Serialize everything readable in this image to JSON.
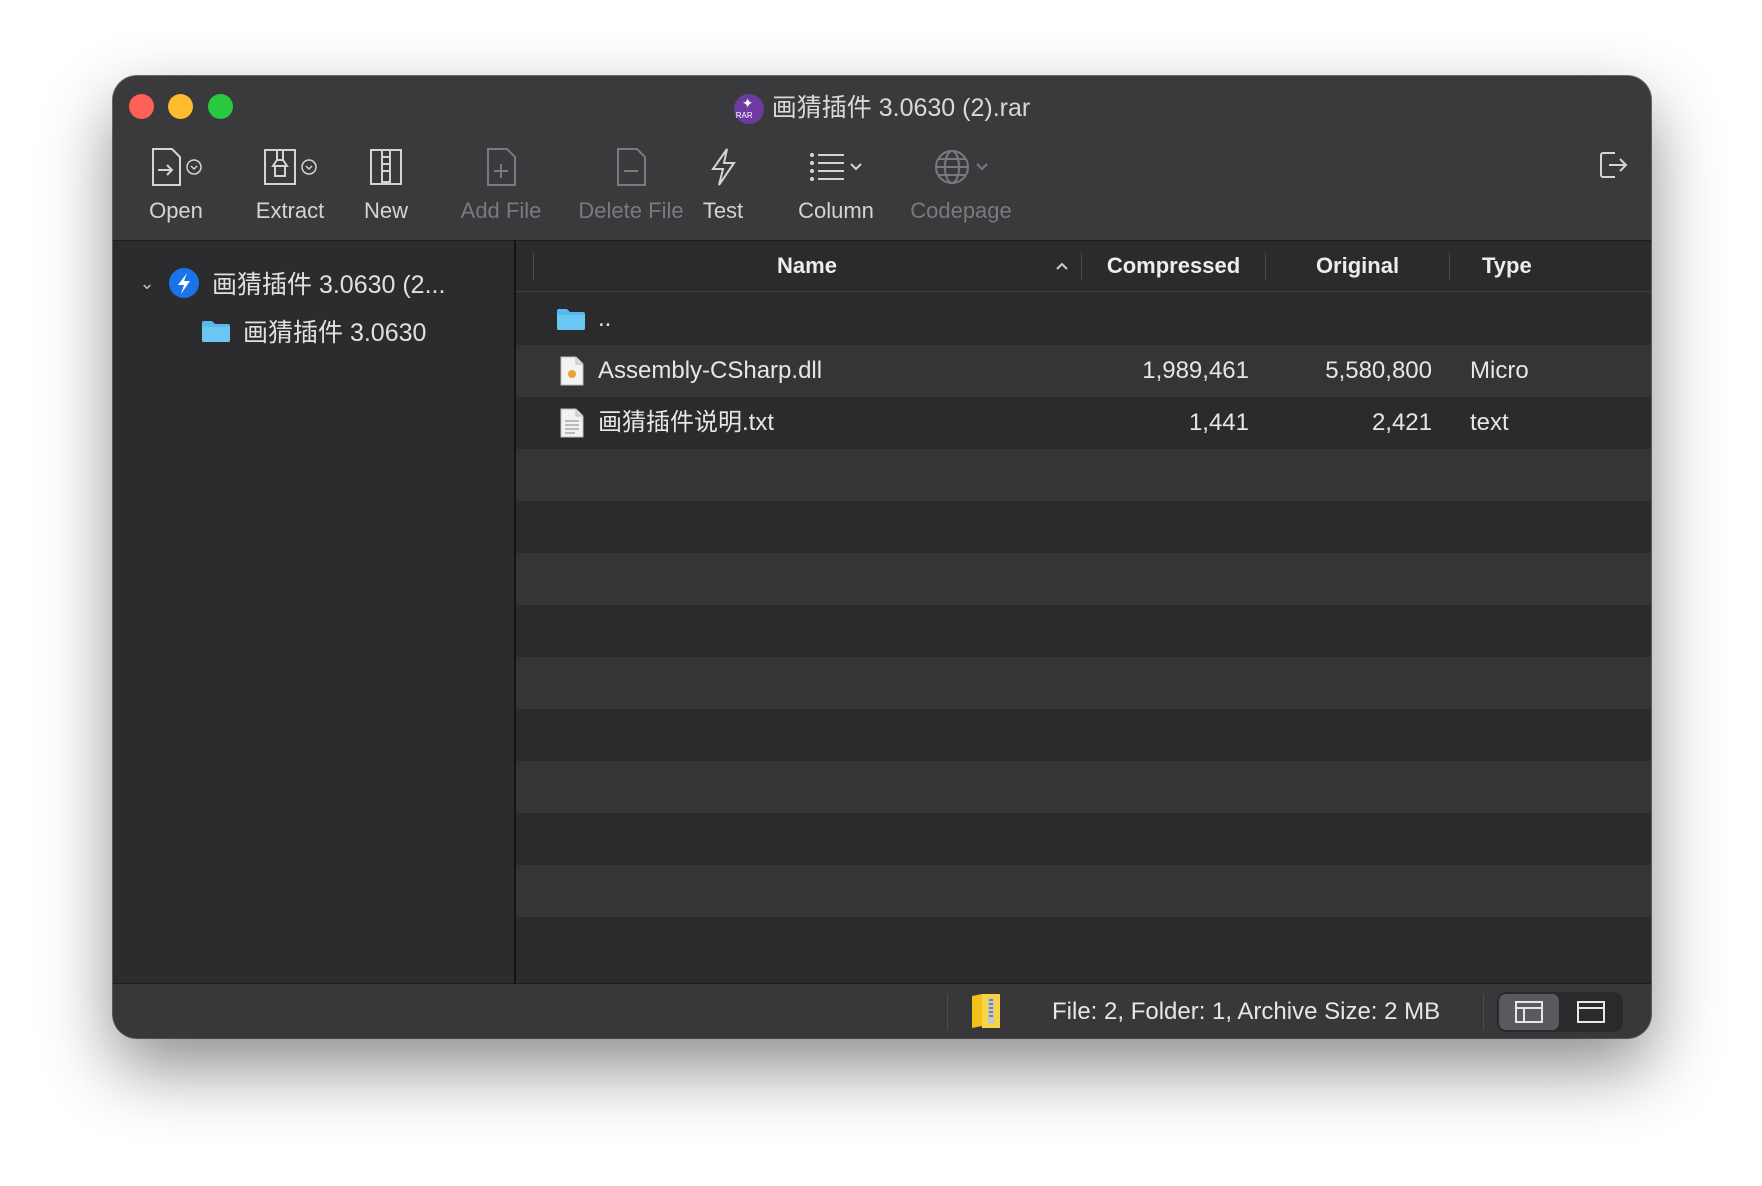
{
  "window": {
    "title": "画猜插件 3.0630 (2).rar"
  },
  "toolbar": {
    "open_label": "Open",
    "extract_label": "Extract",
    "new_label": "New",
    "add_file_label": "Add File",
    "delete_file_label": "Delete File",
    "test_label": "Test",
    "column_label": "Column",
    "codepage_label": "Codepage",
    "icons": [
      "open-icon",
      "extract-icon",
      "new-archive-icon",
      "add-file-icon",
      "delete-file-icon",
      "lightning-icon",
      "list-icon",
      "globe-icon",
      "exit-icon"
    ]
  },
  "sidebar": {
    "items": [
      {
        "label": "画猜插件 3.0630 (2...",
        "icon": "rar-archive-icon",
        "expanded": true
      },
      {
        "label": "画猜插件 3.0630",
        "icon": "folder-icon"
      }
    ]
  },
  "table": {
    "columns": [
      "Name",
      "Compressed",
      "Original",
      "Type"
    ],
    "sort_column": "Name",
    "sort_direction": "ascending",
    "rows": [
      {
        "name": "..",
        "compressed": "",
        "original": "",
        "type": "",
        "icon": "folder-icon"
      },
      {
        "name": "Assembly-CSharp.dll",
        "compressed": "1,989,461",
        "original": "5,580,800",
        "type": "Micro",
        "icon": "dll-file-icon"
      },
      {
        "name": "画猜插件说明.txt",
        "compressed": "1,441",
        "original": "2,421",
        "type": "text",
        "icon": "text-file-icon"
      }
    ]
  },
  "status": {
    "text": "File: 2, Folder: 1, Archive Size: 2 MB",
    "icons": [
      "archive-book-icon",
      "split-view-icon",
      "single-view-icon"
    ]
  },
  "colors": {
    "window_bg": "#2b2b2e",
    "toolbar_bg": "#3a3a3c",
    "stripe": "#353538",
    "folder": "#58b9ee",
    "accent": "#1a73e8",
    "traffic_red": "#fe5f57",
    "traffic_yellow": "#febc2e",
    "traffic_green": "#28c840"
  }
}
